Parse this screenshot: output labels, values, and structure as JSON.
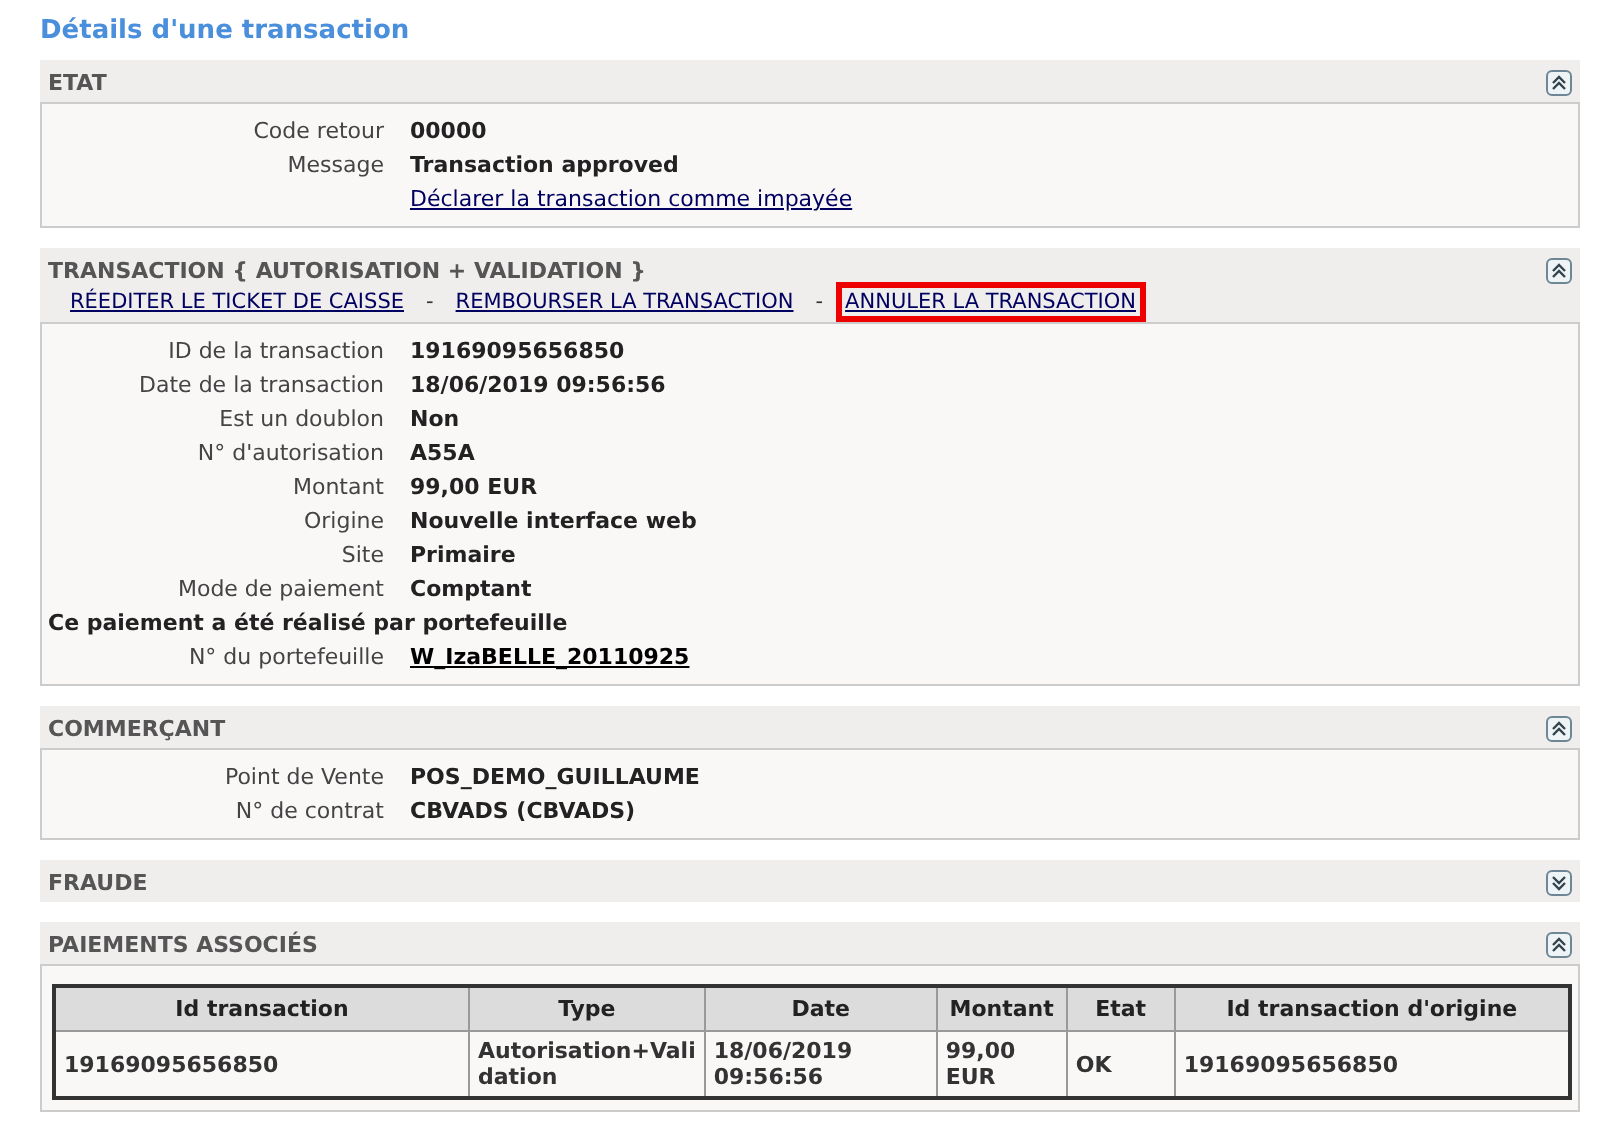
{
  "title": "Détails d'une transaction",
  "sections": [
    {
      "title": "ETAT",
      "expanded": true,
      "fields": [
        {
          "kind": "field",
          "label": "Code retour",
          "value": "00000"
        },
        {
          "kind": "field",
          "label": "Message",
          "value": "Transaction approved"
        },
        {
          "kind": "link",
          "value": "Déclarer la transaction comme impayée"
        }
      ]
    },
    {
      "title": "TRANSACTION { AUTORISATION + VALIDATION }",
      "expanded": true,
      "action_separator": "-",
      "actions": [
        {
          "label": "RÉEDITER LE TICKET DE CAISSE",
          "highlighted": false
        },
        {
          "label": "REMBOURSER LA TRANSACTION",
          "highlighted": false
        },
        {
          "label": "ANNULER LA TRANSACTION",
          "highlighted": true
        }
      ],
      "fields": [
        {
          "kind": "field",
          "label": "ID de la transaction",
          "value": "19169095656850"
        },
        {
          "kind": "field",
          "label": "Date de la transaction",
          "value": "18/06/2019 09:56:56"
        },
        {
          "kind": "field",
          "label": "Est un doublon",
          "value": "Non"
        },
        {
          "kind": "field",
          "label": "N° d'autorisation",
          "value": "A55A"
        },
        {
          "kind": "field",
          "label": "Montant",
          "value": "99,00 EUR"
        },
        {
          "kind": "field",
          "label": "Origine",
          "value": "Nouvelle interface web"
        },
        {
          "kind": "field",
          "label": "Site",
          "value": "Primaire"
        },
        {
          "kind": "field",
          "label": "Mode de paiement",
          "value": "Comptant"
        },
        {
          "kind": "note",
          "value": "Ce paiement a été réalisé par portefeuille"
        },
        {
          "kind": "field_link",
          "label": "N° du portefeuille",
          "value": "W_IzaBELLE_20110925"
        }
      ]
    },
    {
      "title": "COMMERÇANT",
      "expanded": true,
      "fields": [
        {
          "kind": "field",
          "label": "Point de Vente",
          "value": "POS_DEMO_GUILLAUME"
        },
        {
          "kind": "field",
          "label": "N° de contrat",
          "value": "CBVADS (CBVADS)"
        }
      ]
    },
    {
      "title": "FRAUDE",
      "expanded": false
    },
    {
      "title": "PAIEMENTS ASSOCIÉS",
      "expanded": true,
      "table": {
        "columns": [
          "Id transaction",
          "Type",
          "Date",
          "Montant",
          "Etat",
          "Id transaction d'origine"
        ],
        "rows": [
          [
            "19169095656850",
            "Autorisation+Vali dation",
            "18/06/2019 09:56:56",
            "99,00 EUR",
            "OK",
            "19169095656850"
          ]
        ]
      }
    }
  ]
}
